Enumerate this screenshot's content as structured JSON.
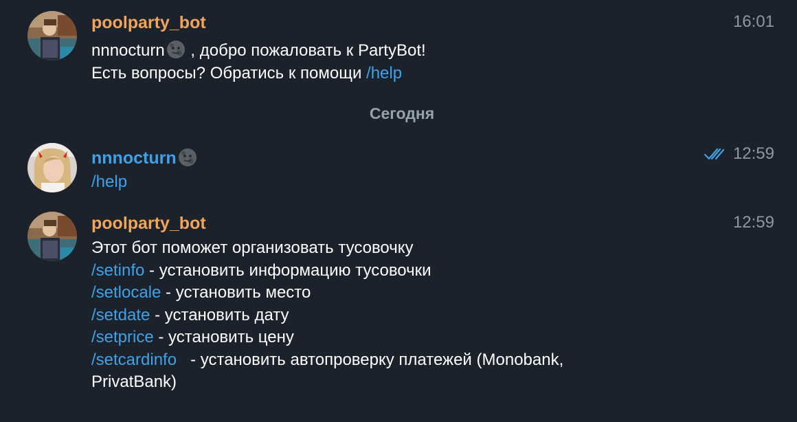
{
  "messages": [
    {
      "sender": "poolparty_bot",
      "time": "16:01",
      "avatar": "bot-avatar",
      "lines": [
        {
          "mention": "nnnocturn",
          "text": " , добро пожаловать к PartyBot!"
        },
        {
          "text": "Есть вопросы? Обратись к помощи ",
          "command": "/help"
        }
      ]
    },
    {
      "sender": "nnnocturn",
      "time": "12:59",
      "status_icon": "double-check-icon",
      "avatar": "user-avatar",
      "text": "/help"
    },
    {
      "sender": "poolparty_bot",
      "time": "12:59",
      "avatar": "bot-avatar",
      "intro": "Этот бот поможет организовать тусовочку",
      "commands": [
        {
          "command": "/setinfo",
          "description": " - установить информацию тусовочки"
        },
        {
          "command": "/setlocale",
          "description": " - установить место"
        },
        {
          "command": "/setdate",
          "description": " - установить дату"
        },
        {
          "command": "/setprice",
          "description": " - установить цену"
        },
        {
          "command": "/setcardinfo",
          "description": "   - установить автопроверку платежей (Monobank,"
        }
      ],
      "last_line": "PrivatBank)"
    }
  ],
  "date_divider": "Сегодня",
  "colors": {
    "background": "#1b222b",
    "bot_name": "#f0a55b",
    "user_name": "#3fa2e8",
    "link": "#3fa2e8",
    "time": "#8e98a3"
  }
}
